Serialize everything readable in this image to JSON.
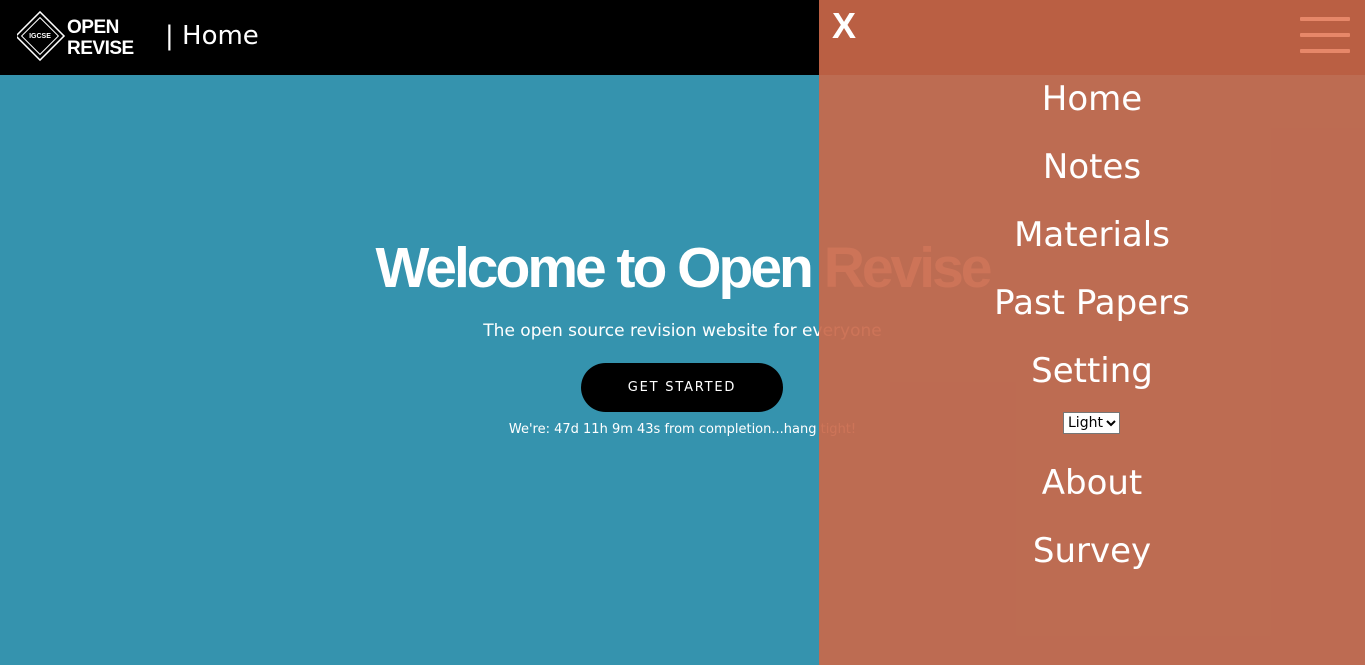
{
  "header": {
    "logo": {
      "badge_text": "IGCSE",
      "line1": "OPEN",
      "line2": "REVISE"
    },
    "page_title": "| Home"
  },
  "hero": {
    "title": "Welcome to Open Revise",
    "subtitle": "The open source revision website for everyone",
    "cta_label": "GET STARTED",
    "countdown": "We're: 47d 11h 9m 43s from completion...hang tight!"
  },
  "menu": {
    "close_label": "X",
    "items": [
      {
        "label": "Home"
      },
      {
        "label": "Notes"
      },
      {
        "label": "Materials"
      },
      {
        "label": "Past Papers"
      },
      {
        "label": "Setting"
      },
      {
        "label": "About"
      },
      {
        "label": "Survey"
      }
    ],
    "theme_select": {
      "selected": "Light"
    }
  },
  "colors": {
    "header_bg": "#000000",
    "hero_bg": "#3593ae",
    "overlay_bg": "#c9684a",
    "text": "#ffffff"
  },
  "icons": {
    "close": "close-icon",
    "menu": "hamburger-menu-icon",
    "logo": "open-revise-logo"
  }
}
